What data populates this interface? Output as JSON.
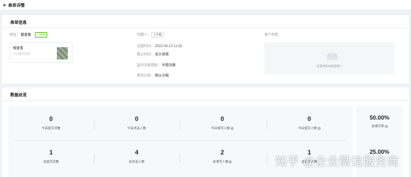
{
  "header": {
    "title": "表单详情"
  },
  "form_info": {
    "section_title": "表单信息",
    "preview_label": "预览：",
    "preview_value": "郁金香",
    "status_tag": "已发布",
    "preview_card": {
      "name": "郁金香",
      "subtitle": "已以填写的答"
    },
    "creator_label": "创建人：",
    "creator_value": "J.宁皑",
    "created_time_label": "创建时间：",
    "created_time_value": "2022-04-13 11:33",
    "deadline_label": "截止时间：",
    "deadline_value": "永久有效",
    "submit_limit_label": "提交次数限制：",
    "submit_limit_value": "不限次数",
    "group_label": "表单分组：",
    "group_value": "默认分组",
    "tags_label": "客户标签：",
    "tags_empty_text": "设表单没有标签哦～"
  },
  "overview": {
    "section_title": "数据总览",
    "stats_row1": [
      {
        "value": "0",
        "label": "今日提交次数"
      },
      {
        "value": "0",
        "label": "今日点击人数"
      },
      {
        "value": "0",
        "label": "今日填写人数"
      },
      {
        "value": "0",
        "label": "今日提交人数"
      }
    ],
    "stats_row2": [
      {
        "value": "1",
        "label": "总提交次数"
      },
      {
        "value": "4",
        "label": "总点击人数"
      },
      {
        "value": "2",
        "label": "总填写人数"
      },
      {
        "value": "1",
        "label": "总提交人数"
      }
    ],
    "rates": [
      {
        "value": "50.00%",
        "label": "总填写率"
      },
      {
        "value": "25.00%",
        "label": ""
      }
    ]
  },
  "watermark": "知乎 @企业微信服务商",
  "icons": {
    "back": "arrow-left-icon",
    "empty_box": "empty-box-icon",
    "help": "question-icon"
  }
}
